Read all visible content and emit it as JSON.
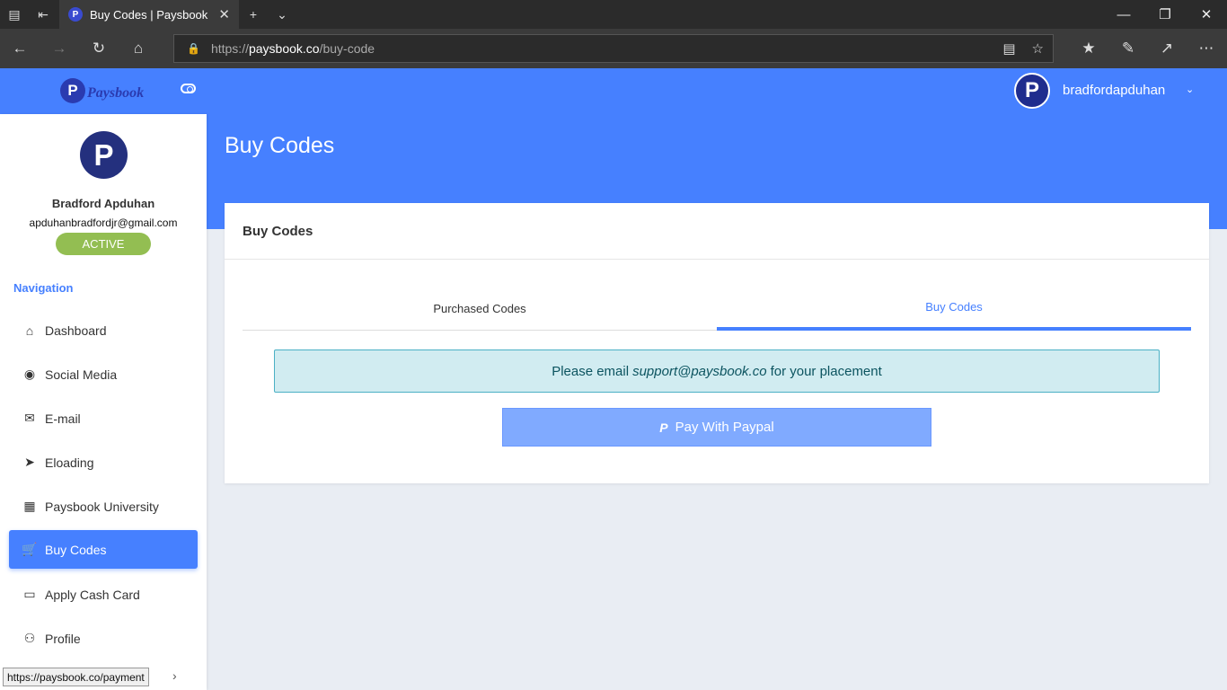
{
  "browser": {
    "tab_title": "Buy Codes | Paysbook",
    "favicon_letter": "P",
    "url_prefix": "https://",
    "url_host": "paysbook.co",
    "url_path": "/buy-code",
    "status_url": "https://paysbook.co/payment"
  },
  "header": {
    "logo_text": "Paysbook",
    "logo_letter": "P",
    "username": "bradfordapduhan"
  },
  "page": {
    "title": "Buy Codes"
  },
  "profile": {
    "name": "Bradford Apduhan",
    "email": "apduhanbradfordjr@gmail.com",
    "status": "ACTIVE"
  },
  "sidebar": {
    "heading": "Navigation",
    "items": [
      {
        "label": "Dashboard",
        "icon": "home-icon"
      },
      {
        "label": "Social Media",
        "icon": "globe-icon"
      },
      {
        "label": "E-mail",
        "icon": "mail-icon"
      },
      {
        "label": "Eloading",
        "icon": "send-icon"
      },
      {
        "label": "Paysbook University",
        "icon": "film-icon"
      },
      {
        "label": "Buy Codes",
        "icon": "cart-icon",
        "active": true
      },
      {
        "label": "Apply Cash Card",
        "icon": "card-icon"
      },
      {
        "label": "Profile",
        "icon": "user-icon"
      }
    ]
  },
  "card": {
    "title": "Buy Codes",
    "tabs": [
      {
        "label": "Purchased Codes"
      },
      {
        "label": "Buy Codes",
        "active": true
      }
    ],
    "alert_prefix": "Please email",
    "alert_email": "support@paysbook.co",
    "alert_suffix": "for your placement",
    "paypal_button": "Pay With Paypal"
  },
  "colors": {
    "primary": "#4680ff",
    "active_badge": "#93be52",
    "alert_bg": "#d1ecf1"
  }
}
